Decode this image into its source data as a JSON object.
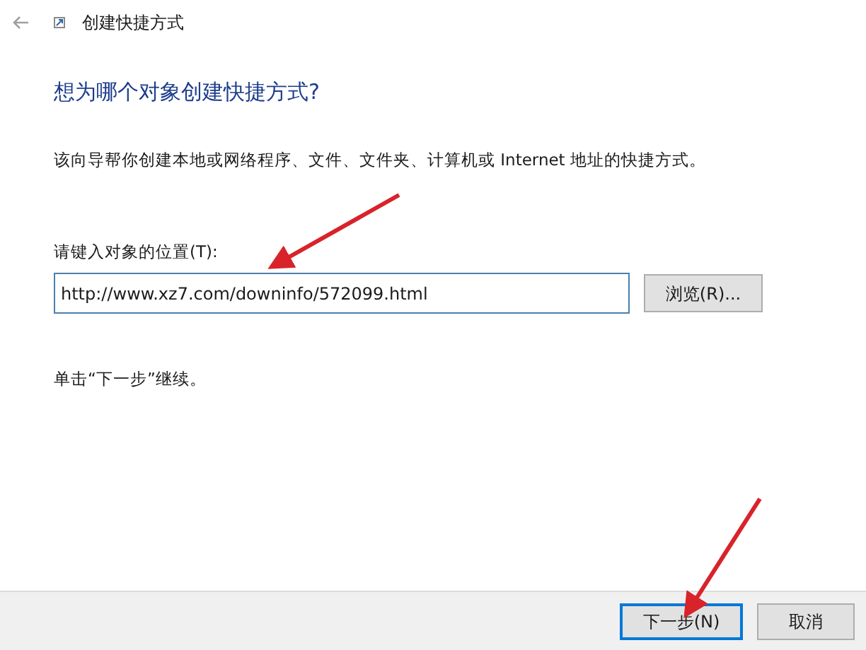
{
  "window": {
    "title": "创建快捷方式"
  },
  "heading": "想为哪个对象创建快捷方式?",
  "description": "该向导帮你创建本地或网络程序、文件、文件夹、计算机或 Internet 地址的快捷方式。",
  "location": {
    "label": "请键入对象的位置(T):",
    "value": "http://www.xz7.com/downinfo/572099.html",
    "browse_button": "浏览(R)..."
  },
  "hint": "单击“下一步”继续。",
  "buttons": [
    {
      "label": "下一步(N)",
      "default": true
    },
    {
      "label": "取消",
      "default": false
    }
  ]
}
